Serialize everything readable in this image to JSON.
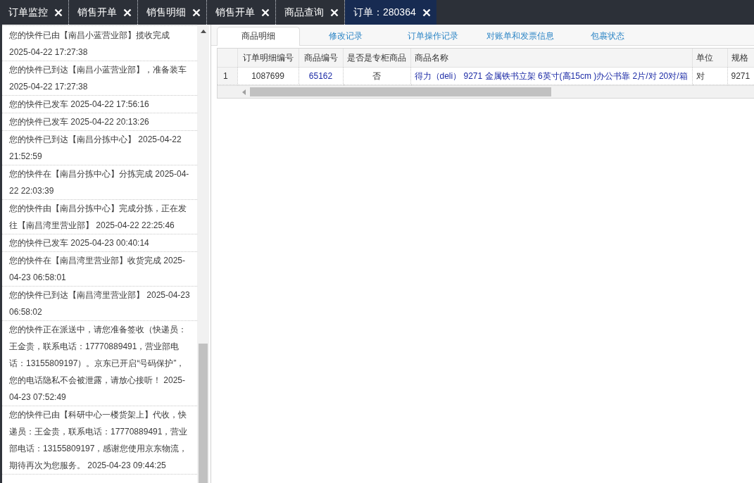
{
  "top_tabs": [
    {
      "label": "订单监控",
      "selected": false
    },
    {
      "label": "销售开单",
      "selected": false
    },
    {
      "label": "销售明细",
      "selected": false
    },
    {
      "label": "销售开单",
      "selected": false
    },
    {
      "label": "商品查询",
      "selected": false
    },
    {
      "label": "订单：280364",
      "selected": true
    }
  ],
  "tracking_log": {
    "entries": [
      "您的快件已由【南昌小蓝营业部】揽收完成 2025-04-22 17:27:38",
      "您的快件已到达【南昌小蓝营业部】，准备装车 2025-04-22 17:27:38",
      "您的快件已发车 2025-04-22 17:56:16",
      "您的快件已发车 2025-04-22 20:13:26",
      "您的快件已到达【南昌分拣中心】 2025-04-22 21:52:59",
      "您的快件在【南昌分拣中心】分拣完成 2025-04-22 22:03:39",
      "您的快件由【南昌分拣中心】完成分拣，正在发往【南昌湾里营业部】 2025-04-22 22:25:46",
      "您的快件已发车 2025-04-23 00:40:14",
      "您的快件在【南昌湾里营业部】收货完成 2025-04-23 06:58:01",
      "您的快件已到达【南昌湾里营业部】 2025-04-23 06:58:02",
      "您的快件正在派送中，请您准备签收（快递员：王金贵，联系电话：17770889491，营业部电话：13155809197）。京东已开启“号码保护”，您的电话隐私不会被泄露，请放心接听！ 2025-04-23 07:52:49",
      "您的快件已由【科研中心一楼货架上】代收，快递员：王金贵，联系电话：17770889491，营业部电话：13155809197，感谢您使用京东物流，期待再次为您服务。 2025-04-23 09:44:25"
    ]
  },
  "detail_tabs": [
    {
      "label": "商品明细",
      "selected": true
    },
    {
      "label": "修改记录",
      "selected": false
    },
    {
      "label": "订单操作记录",
      "selected": false
    },
    {
      "label": "对账单和发票信息",
      "selected": false
    },
    {
      "label": "包裹状态",
      "selected": false
    }
  ],
  "items_table": {
    "columns": [
      "订单明细编号",
      "商品编号",
      "是否是专柜商品",
      "商品名称",
      "单位",
      "规格"
    ],
    "rows": [
      {
        "row_number": "1",
        "cells": [
          {
            "text": "1087699",
            "kind": "plain"
          },
          {
            "text": "65162",
            "kind": "link"
          },
          {
            "text": "否",
            "kind": "plain"
          },
          {
            "text": "得力（deli） 9271 金属铁书立架 6英寸(高15cm )办公书靠 2片/对 20对/箱",
            "kind": "link"
          },
          {
            "text": "对",
            "kind": "plain"
          },
          {
            "text": "9271",
            "kind": "plain"
          }
        ]
      }
    ]
  }
}
